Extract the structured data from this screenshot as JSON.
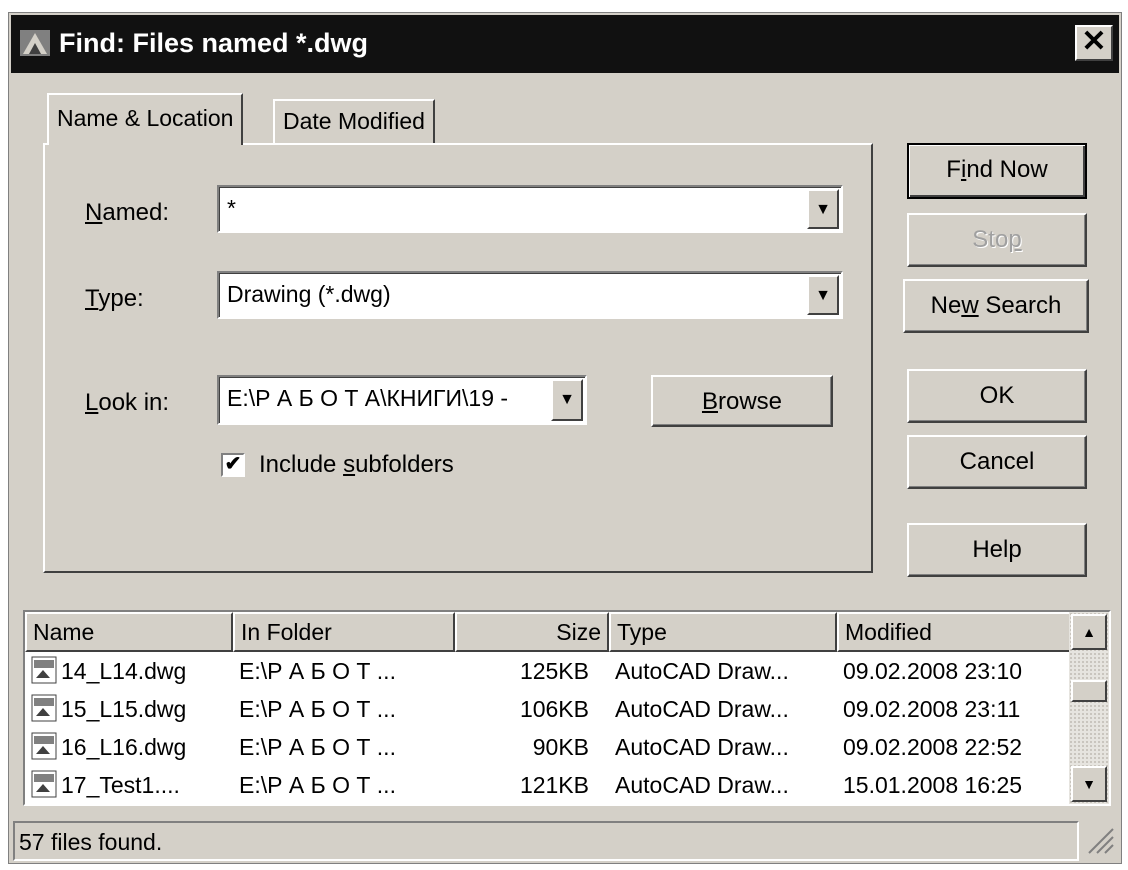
{
  "window": {
    "title": "Find: Files named *.dwg",
    "close_glyph": "✕",
    "app_icon": "autocad-app-icon",
    "close_icon": "close-x-icon"
  },
  "tabs": [
    {
      "label": "Name & Location",
      "active": true
    },
    {
      "label": "Date Modified",
      "active": false
    }
  ],
  "form": {
    "named": {
      "label_prefix": "",
      "label_mnemonic": "N",
      "label_rest": "amed:",
      "value": "*"
    },
    "type": {
      "label_prefix": "",
      "label_mnemonic": "T",
      "label_rest": "ype:",
      "value": "Drawing (*.dwg)"
    },
    "look_in": {
      "label_prefix": "",
      "label_mnemonic": "L",
      "label_rest": "ook in:",
      "value": "E:\\Р А Б О Т А\\КНИГИ\\19 -"
    },
    "browse": {
      "label_mnemonic": "B",
      "label_rest": "rowse"
    },
    "include_subfolders": {
      "prefix": "Include ",
      "mnemonic": "s",
      "rest": "ubfolders",
      "checked": true,
      "check_glyph": "✔"
    },
    "dropdown_glyph": "▼"
  },
  "buttons": {
    "find_now": {
      "prefix": "F",
      "mnemonic": "i",
      "rest": "nd Now"
    },
    "stop": {
      "prefix": "Sto",
      "mnemonic": "p",
      "rest": "",
      "disabled": true
    },
    "new_search": {
      "prefix": "Ne",
      "mnemonic": "w",
      "rest": " Search"
    },
    "ok": "OK",
    "cancel": "Cancel",
    "help": "Help"
  },
  "results": {
    "columns": [
      "Name",
      "In Folder",
      "Size",
      "Type",
      "Modified"
    ],
    "rows": [
      {
        "name": "14_L14.dwg",
        "folder": "E:\\Р А Б О Т ...",
        "size": "125KB",
        "type": "AutoCAD Draw...",
        "modified": "09.02.2008 23:10"
      },
      {
        "name": "15_L15.dwg",
        "folder": "E:\\Р А Б О Т ...",
        "size": "106KB",
        "type": "AutoCAD Draw...",
        "modified": "09.02.2008 23:11"
      },
      {
        "name": "16_L16.dwg",
        "folder": "E:\\Р А Б О Т ...",
        "size": "90KB",
        "type": "AutoCAD Draw...",
        "modified": "09.02.2008 22:52"
      },
      {
        "name": "17_Test1....",
        "folder": "E:\\Р А Б О Т ...",
        "size": "121KB",
        "type": "AutoCAD Draw...",
        "modified": "15.01.2008 16:25"
      }
    ],
    "scroll_up_glyph": "▲",
    "scroll_down_glyph": "▼",
    "file_icon": "dwg-file-icon"
  },
  "status": {
    "text": "57 files found.",
    "grip_icon": "resize-grip-icon"
  }
}
